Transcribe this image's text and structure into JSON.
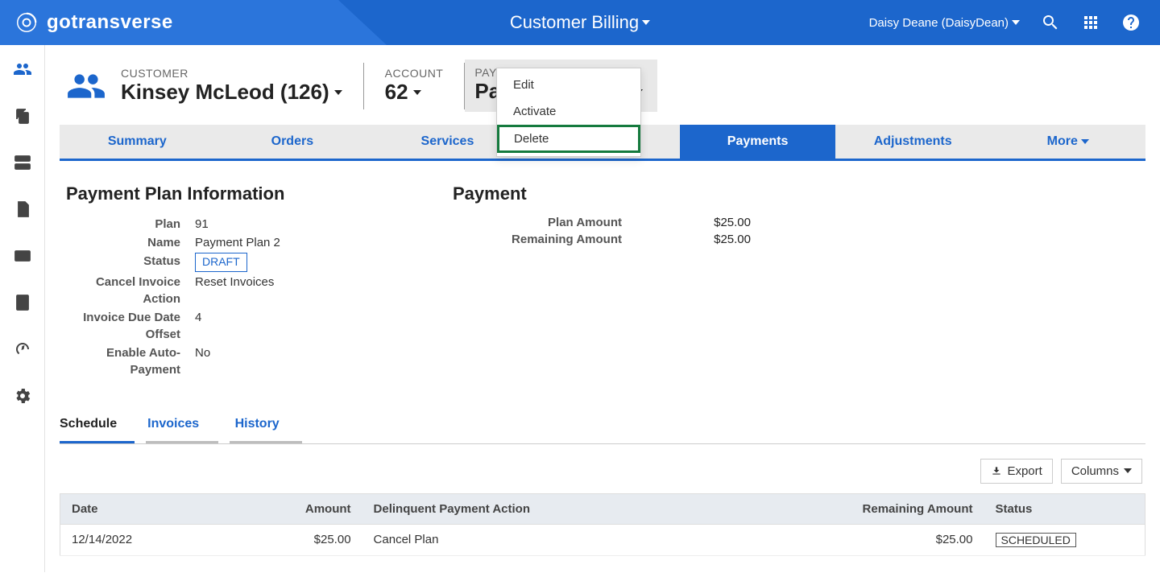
{
  "brand": "gotransverse",
  "top_title": "Customer Billing",
  "user": "Daisy Deane (DaisyDean)",
  "breadcrumb": {
    "customer_label": "CUSTOMER",
    "customer_value": "Kinsey McLeod (126)",
    "account_label": "ACCOUNT",
    "account_value": "62",
    "plan_label": "PAYMENT PLAN",
    "plan_id": "91",
    "plan_value": "Payment Plan 2"
  },
  "dropdown": {
    "items": [
      "Edit",
      "Activate",
      "Delete"
    ],
    "highlighted": "Delete"
  },
  "main_tabs": [
    "Summary",
    "Orders",
    "Services",
    "",
    "Payments",
    "Adjustments"
  ],
  "main_tabs_more": "More",
  "main_tab_active": "Payments",
  "plan_info": {
    "title": "Payment Plan Information",
    "rows": [
      {
        "label": "Plan",
        "value": "91"
      },
      {
        "label": "Name",
        "value": "Payment Plan 2"
      },
      {
        "label": "Status",
        "value": "DRAFT",
        "badge": true
      },
      {
        "label": "Cancel Invoice Action",
        "value": "Reset Invoices"
      },
      {
        "label": "Invoice Due Date Offset",
        "value": "4"
      },
      {
        "label": "Enable Auto-Payment",
        "value": "No"
      }
    ]
  },
  "plan_summary": {
    "title": "Payment",
    "rows": [
      {
        "label": "Plan Amount",
        "value": "$25.00"
      },
      {
        "label": "Remaining Amount",
        "value": "$25.00"
      }
    ]
  },
  "sub_tabs": [
    "Schedule",
    "Invoices",
    "History"
  ],
  "sub_tab_active": "Schedule",
  "actions": {
    "export": "Export",
    "columns": "Columns"
  },
  "table": {
    "headers": [
      "Date",
      "Amount",
      "Delinquent Payment Action",
      "Remaining Amount",
      "Status"
    ],
    "rows": [
      {
        "date": "12/14/2022",
        "amount": "$25.00",
        "action": "Cancel Plan",
        "remaining": "$25.00",
        "status": "SCHEDULED"
      }
    ]
  }
}
